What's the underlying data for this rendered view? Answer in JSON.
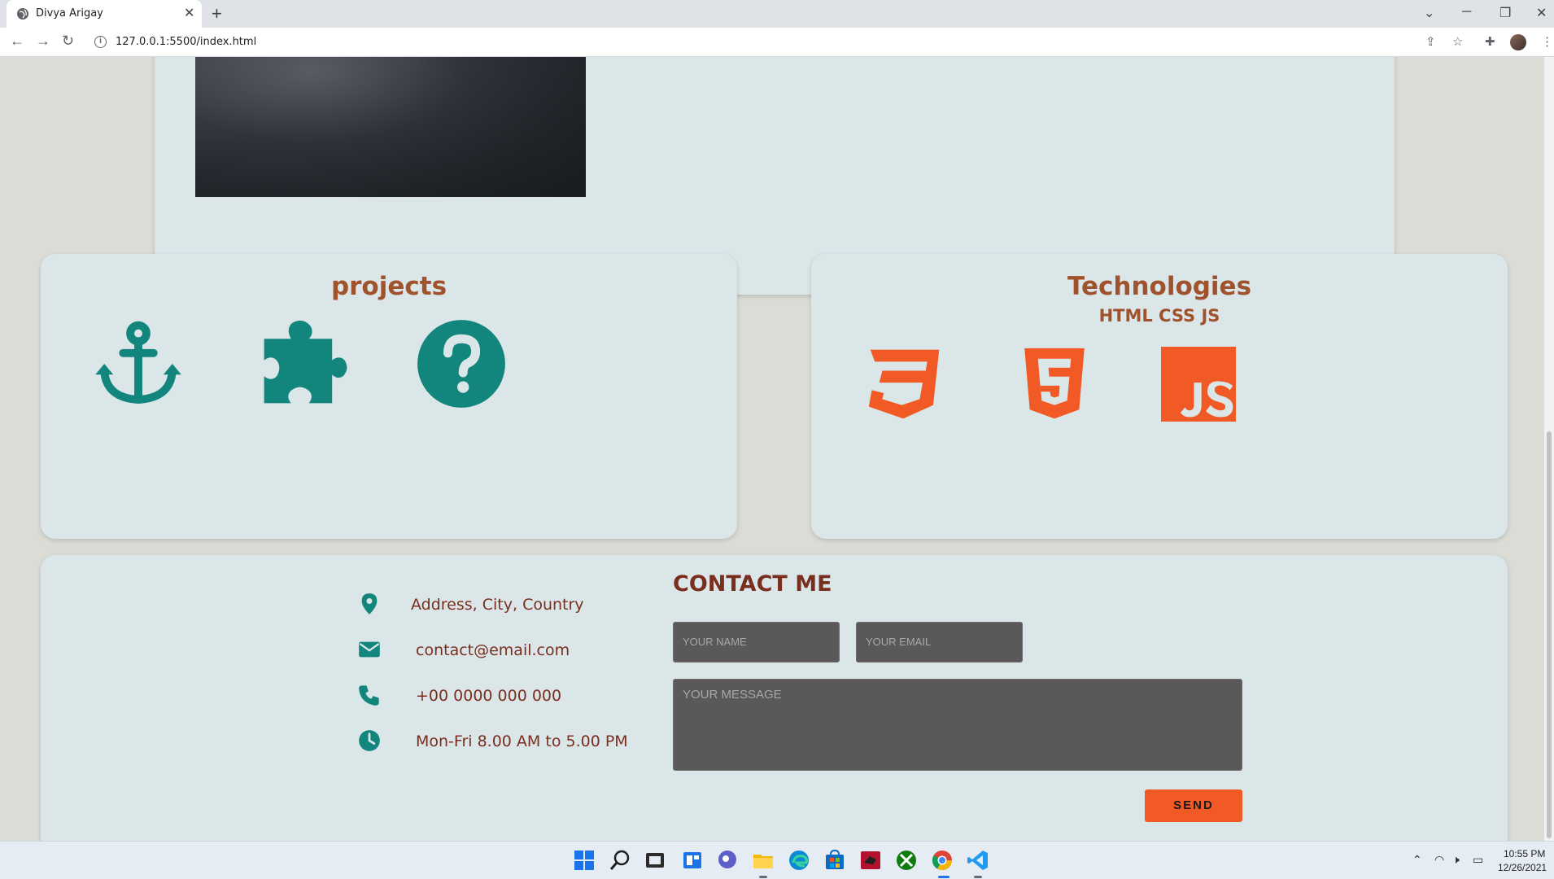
{
  "browser": {
    "tab_title": "Divya Arigay",
    "url": "127.0.0.1:5500/index.html"
  },
  "projects": {
    "title": "projects",
    "icons": [
      "anchor-icon",
      "puzzle-piece-icon",
      "question-circle-icon"
    ]
  },
  "technologies": {
    "title": "Technologies",
    "subtitle": "HTML CSS JS",
    "icons": [
      "css3-icon",
      "html5-icon",
      "javascript-icon"
    ]
  },
  "contact": {
    "title": "CONTACT ME",
    "items": [
      {
        "icon": "location-pin-icon",
        "text": "Address, City, Country"
      },
      {
        "icon": "envelope-icon",
        "text": "contact@email.com"
      },
      {
        "icon": "phone-icon",
        "text": "+00 0000 000 000"
      },
      {
        "icon": "clock-icon",
        "text": "Mon-Fri 8.00 AM to 5.00 PM"
      }
    ],
    "name_placeholder": "YOUR NAME",
    "email_placeholder": "YOUR EMAIL",
    "message_placeholder": "YOUR MESSAGE",
    "send_label": "SEND"
  },
  "taskbar": {
    "time": "10:55 PM",
    "date": "12/26/2021"
  },
  "colors": {
    "heading": "#a0522d",
    "contact_text": "#7a2e1e",
    "icon_teal": "#12857c",
    "accent_orange": "#f15a24",
    "card_bg": "#dbe6e9"
  }
}
